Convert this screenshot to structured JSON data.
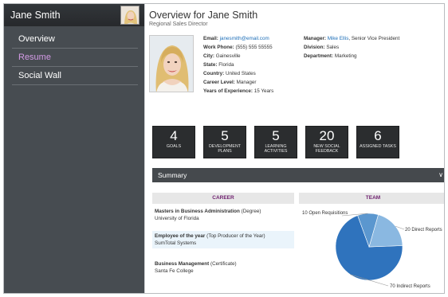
{
  "sidebar": {
    "user_name": "Jane Smith",
    "items": [
      {
        "label": "Overview",
        "active": false
      },
      {
        "label": "Resume",
        "active": true
      },
      {
        "label": "Social Wall",
        "active": false
      }
    ]
  },
  "header": {
    "title": "Overview for Jane Smith",
    "subtitle": "Regional Sales Director"
  },
  "details_left": [
    {
      "label": "Email:",
      "value": "janesmith@email.com",
      "is_link": true
    },
    {
      "label": "Work Phone:",
      "value": "(555) 555 55555"
    },
    {
      "label": "City:",
      "value": "Gainesville"
    },
    {
      "label": "State:",
      "value": "Florida"
    },
    {
      "label": "Country:",
      "value": "United States"
    },
    {
      "label": "Career Level:",
      "value": "Manager"
    },
    {
      "label": "Years of Experience:",
      "value": "15 Years"
    }
  ],
  "details_right": {
    "manager_label": "Manager:",
    "manager_name": "Mike Ellis",
    "manager_title": ", Senior Vice President",
    "division_label": "Division:",
    "division_value": "Sales",
    "department_label": "Department:",
    "department_value": "Marketing"
  },
  "tiles": [
    {
      "value": "4",
      "label": "Goals"
    },
    {
      "value": "5",
      "label": "Development Plans"
    },
    {
      "value": "5",
      "label": "Learning Activities"
    },
    {
      "value": "20",
      "label": "New Social Feedback"
    },
    {
      "value": "6",
      "label": "Assigned Tasks"
    }
  ],
  "summary": {
    "label": "Summary",
    "career_heading": "CAREER",
    "team_heading": "TEAM",
    "career_items": [
      {
        "title": "Masters in Business Administration",
        "detail": "(Degree)",
        "org": "University of Florida"
      },
      {
        "title": "Employee of the year",
        "detail": "(Top Producer of the Year)",
        "org": "SumTotal Systems"
      },
      {
        "title": "Business Management",
        "detail": "(Certificate)",
        "org": "Santa Fe College"
      }
    ]
  },
  "chart_data": {
    "type": "pie",
    "categories": [
      "Open Requisitions",
      "Direct Reports",
      "Indirect Reports"
    ],
    "values": [
      10,
      20,
      70
    ],
    "labels": [
      "10 Open  Requisitions",
      "20 Direct Reports",
      "70 Indirect Reports"
    ],
    "colors": [
      "#5b97cf",
      "#8ab8e1",
      "#2f73bd"
    ]
  }
}
